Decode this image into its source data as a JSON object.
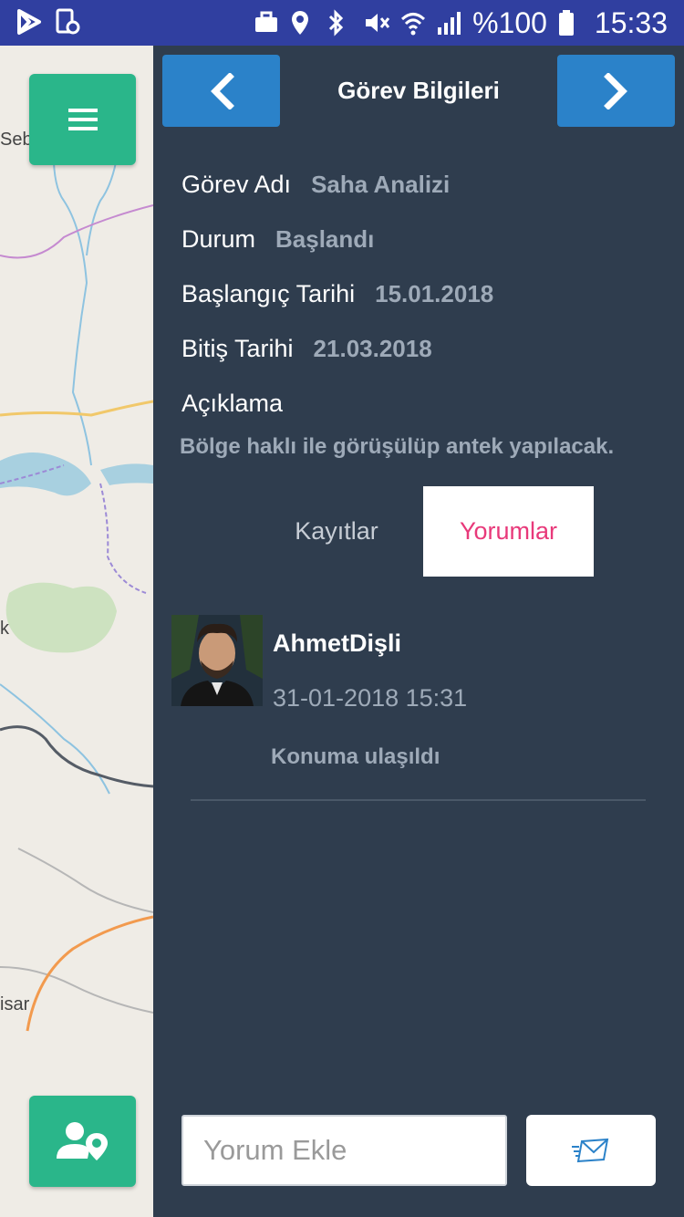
{
  "status_bar": {
    "battery_text": "%100",
    "time": "15:33",
    "icons": [
      "play-store-icon",
      "screenshot-icon",
      "briefcase-icon",
      "location-icon",
      "bluetooth-icon",
      "mute-icon",
      "wifi-icon",
      "signal-icon",
      "battery-icon"
    ]
  },
  "map": {
    "labels": [
      "Sebo",
      "k",
      "isar"
    ]
  },
  "header": {
    "title": "Görev Bilgileri",
    "prev_icon": "chevron-left-icon",
    "next_icon": "chevron-right-icon"
  },
  "task": {
    "name_label": "Görev Adı",
    "name_value": "Saha Analizi",
    "status_label": "Durum",
    "status_value": "Başlandı",
    "start_label": "Başlangıç Tarihi",
    "start_value": "15.01.2018",
    "end_label": "Bitiş Tarihi",
    "end_value": "21.03.2018",
    "description_label": "Açıklama",
    "description_value": "Bölge haklı ile görüşülüp antek yapılacak."
  },
  "tabs": [
    {
      "label": "Kayıtlar",
      "active": false
    },
    {
      "label": "Yorumlar",
      "active": true
    }
  ],
  "comments": [
    {
      "author": "AhmetDişli",
      "date": "31-01-2018 15:31",
      "text": "Konuma ulaşıldı"
    }
  ],
  "comment_box": {
    "placeholder": "Yorum Ekle",
    "send_icon": "send-mail-icon"
  },
  "colors": {
    "panel_bg": "#2f3d4e",
    "nav_button": "#2b82c9",
    "fab": "#2ab68a",
    "active_tab_text": "#e8397a",
    "status_bar": "#303fa0"
  }
}
